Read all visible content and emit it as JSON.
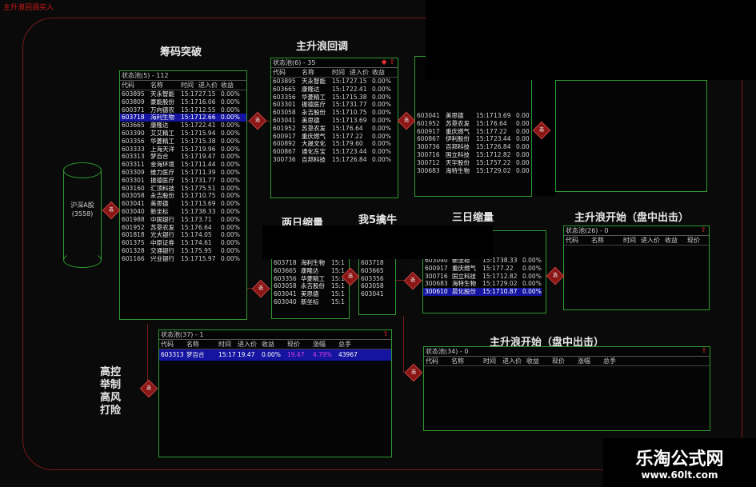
{
  "app": {
    "title": "主升浪回调买入"
  },
  "source": {
    "label": "沪深A股",
    "count": "(3558)"
  },
  "sections": {
    "chip_break": "筹码突破",
    "main_pullback": "主升浪回调",
    "two_day_shrink": "两日缩量",
    "my5_bull": "我5擒牛",
    "three_day_shrink": "三日缩量",
    "main_start_a": "主升浪开始（盘中出击）",
    "main_start_b": "主升浪开始（盘中出击）",
    "high_control": "高控举制高风打险"
  },
  "pools": {
    "p1": {
      "title": "状态池(5) - 112",
      "headers": [
        "代码",
        "名称",
        "时间",
        "进入价",
        "收益"
      ],
      "rows": [
        [
          "603895",
          "天永智能",
          "15:17",
          "27.15",
          "0.00%"
        ],
        [
          "603809",
          "豪能股份",
          "15:17",
          "16.06",
          "0.00%"
        ],
        [
          "600371",
          "万向德农",
          "15:17",
          "12.55",
          "0.00%"
        ],
        [
          "603718",
          "海利生物",
          "15:17",
          "12.66",
          "0.00%"
        ],
        [
          "603665",
          "康隆达",
          "15:17",
          "22.41",
          "0.00%"
        ],
        [
          "603390",
          "艾艾精工",
          "15:17",
          "15.94",
          "0.00%"
        ],
        [
          "603356",
          "华菱精工",
          "15:17",
          "15.38",
          "0.00%"
        ],
        [
          "603333",
          "上海天洋",
          "15:17",
          "19.96",
          "0.00%"
        ],
        [
          "603313",
          "梦百合",
          "15:17",
          "19.47",
          "0.00%"
        ],
        [
          "603311",
          "金海环境",
          "15:17",
          "11.44",
          "0.00%"
        ],
        [
          "603309",
          "维力医疗",
          "15:17",
          "11.39",
          "0.00%"
        ],
        [
          "603301",
          "振德医疗",
          "15:17",
          "31.77",
          "0.00%"
        ],
        [
          "603160",
          "汇顶科技",
          "15:17",
          "75.51",
          "0.00%"
        ],
        [
          "603058",
          "永吉股份",
          "15:17",
          "10.75",
          "0.00%"
        ],
        [
          "603041",
          "美思德",
          "15:17",
          "13.69",
          "0.00%"
        ],
        [
          "603040",
          "新坐标",
          "15:17",
          "38.33",
          "0.00%"
        ],
        [
          "601988",
          "中国银行",
          "15:17",
          "3.71",
          "0.00%"
        ],
        [
          "601952",
          "苏垦农发",
          "15:17",
          "6.64",
          "0.00%"
        ],
        [
          "601818",
          "光大银行",
          "15:17",
          "4.05",
          "0.00%"
        ],
        [
          "601375",
          "中原证券",
          "15:17",
          "4.61",
          "0.00%"
        ],
        [
          "601328",
          "交通银行",
          "15:17",
          "5.95",
          "0.00%"
        ],
        [
          "601166",
          "兴业银行",
          "15:17",
          "15.97",
          "0.00%"
        ]
      ]
    },
    "p2": {
      "title": "状态池(6) - 35",
      "headers": [
        "代码",
        "名称",
        "时间",
        "进入价",
        "收益"
      ],
      "rows": [
        [
          "603895",
          "天永智能",
          "15:17",
          "27.15",
          "0.00%"
        ],
        [
          "603665",
          "康隆达",
          "15:17",
          "22.41",
          "0.00%"
        ],
        [
          "603356",
          "华菱精工",
          "15:17",
          "15.38",
          "0.00%"
        ],
        [
          "603301",
          "振德医疗",
          "15:17",
          "31.77",
          "0.00%"
        ],
        [
          "603058",
          "永吉股份",
          "15:17",
          "10.75",
          "0.00%"
        ],
        [
          "603041",
          "美思德",
          "15:17",
          "13.69",
          "0.00%"
        ],
        [
          "601952",
          "苏垦农发",
          "15:17",
          "6.64",
          "0.00%"
        ],
        [
          "600917",
          "重庆燃气",
          "15:17",
          "7.22",
          "0.00%"
        ],
        [
          "600892",
          "大晟文化",
          "15:17",
          "9.60",
          "0.00%"
        ],
        [
          "600867",
          "通化东宝",
          "15:17",
          "23.44",
          "0.00%"
        ],
        [
          "300736",
          "百邦科技",
          "15:17",
          "26.84",
          "0.00%"
        ]
      ]
    },
    "p3": {
      "title": "",
      "headers": [],
      "rows": [
        [
          "603041",
          "美思德",
          "15:17",
          "13.69",
          "0.00"
        ],
        [
          "601952",
          "苏垦农发",
          "15:17",
          "6.64",
          "0.00"
        ],
        [
          "600917",
          "重庆燃气",
          "15:17",
          "7.22",
          "0.00"
        ],
        [
          "600867",
          "伊利股份",
          "15:17",
          "23.44",
          "0.00"
        ],
        [
          "300736",
          "百邦科技",
          "15:17",
          "26.84",
          "0.00"
        ],
        [
          "300716",
          "国立科技",
          "15:17",
          "12.82",
          "0.00"
        ],
        [
          "300712",
          "天宇股份",
          "15:17",
          "57.22",
          "0.00"
        ],
        [
          "300683",
          "海特生物",
          "15:17",
          "29.02",
          "0.00"
        ]
      ]
    },
    "p_two": {
      "rows": [
        [
          "603718",
          "海利生物",
          "15:1"
        ],
        [
          "603665",
          "康隆达",
          "15:1"
        ],
        [
          "603356",
          "华菱精工",
          "15:1"
        ],
        [
          "603058",
          "永吉股份",
          "15:1"
        ],
        [
          "603041",
          "美思德",
          "15:1"
        ],
        [
          "603040",
          "新坐标",
          "15:1"
        ]
      ]
    },
    "p_my5": {
      "rows": [
        [
          "603718"
        ],
        [
          "603665"
        ],
        [
          "603356"
        ],
        [
          "603058"
        ],
        [
          "603041"
        ]
      ]
    },
    "p_three": {
      "rows": [
        [
          "603040",
          "新坐标",
          "15:17",
          "38.33",
          "0.00%"
        ],
        [
          "600917",
          "重庆燃气",
          "15:17",
          "7.22",
          "0.00%"
        ],
        [
          "300716",
          "国立科技",
          "15:17",
          "12.82",
          "0.00%"
        ],
        [
          "300683",
          "海特生物",
          "15:17",
          "29.02",
          "0.00%"
        ],
        [
          "300610",
          "晨化股份",
          "15:17",
          "10.87",
          "0.00%"
        ]
      ]
    },
    "p_start_top": {
      "title": "状态池(26) - 0",
      "headers": [
        "代码",
        "名称",
        "时间",
        "进入价",
        "收益",
        "现价"
      ]
    },
    "p_bottom_left": {
      "title": "状态池(37) - 1",
      "headers": [
        "代码",
        "名称",
        "时间",
        "进入价",
        "收益",
        "现价",
        "涨幅",
        "总手"
      ],
      "row": [
        "603313",
        "梦百合",
        "15:17",
        "19.47",
        "0.00%",
        "19.47",
        "4.79%",
        "43967"
      ]
    },
    "p_start_bottom": {
      "title": "状态池(34) - 0",
      "headers": [
        "代码",
        "名称",
        "时间",
        "进入价",
        "收益",
        "现价",
        "涨幅",
        "总手"
      ]
    }
  },
  "node_label": "选",
  "watermark": {
    "line1": "乐淘公式网",
    "line2": "www.60lt.com"
  },
  "colors": {
    "panel_border": "#2e9a2e",
    "selection": "#1414a0",
    "wire": "#7a1a1a",
    "node": "#8a1616",
    "pct_up": "#e040e0"
  }
}
